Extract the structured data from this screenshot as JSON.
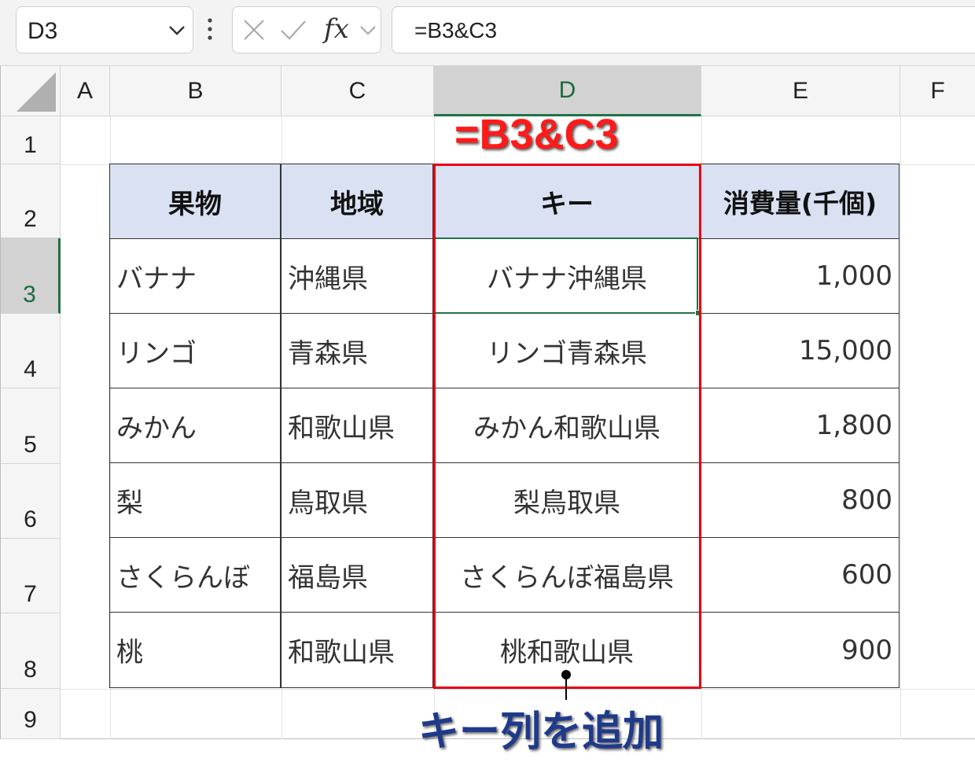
{
  "formula_bar": {
    "name_box": "D3",
    "fx_label": "fx",
    "formula": "=B3&C3"
  },
  "columns": [
    "A",
    "B",
    "C",
    "D",
    "E",
    "F"
  ],
  "rows": [
    "1",
    "2",
    "3",
    "4",
    "5",
    "6",
    "7",
    "8",
    "9"
  ],
  "selected_cell": "D3",
  "table": {
    "headers": [
      "果物",
      "地域",
      "キー",
      "消費量(千個)"
    ],
    "rows": [
      {
        "fruit": "バナナ",
        "region": "沖縄県",
        "key": "バナナ沖縄県",
        "amount": "1,000"
      },
      {
        "fruit": "リンゴ",
        "region": "青森県",
        "key": "リンゴ青森県",
        "amount": "15,000"
      },
      {
        "fruit": "みかん",
        "region": "和歌山県",
        "key": "みかん和歌山県",
        "amount": "1,800"
      },
      {
        "fruit": "梨",
        "region": "鳥取県",
        "key": "梨鳥取県",
        "amount": "800"
      },
      {
        "fruit": "さくらんぼ",
        "region": "福島県",
        "key": "さくらんぼ福島県",
        "amount": "600"
      },
      {
        "fruit": "桃",
        "region": "和歌山県",
        "key": "桃和歌山県",
        "amount": "900"
      }
    ]
  },
  "annotations": {
    "formula_callout": "=B3&C3",
    "column_label": "キー列を追加",
    "highlight_color": "#e60012",
    "label_color": "#1f3a8a"
  },
  "icons": [
    "chevron-down-icon",
    "more-options-icon",
    "cancel-icon",
    "enter-icon",
    "insert-function-icon"
  ]
}
